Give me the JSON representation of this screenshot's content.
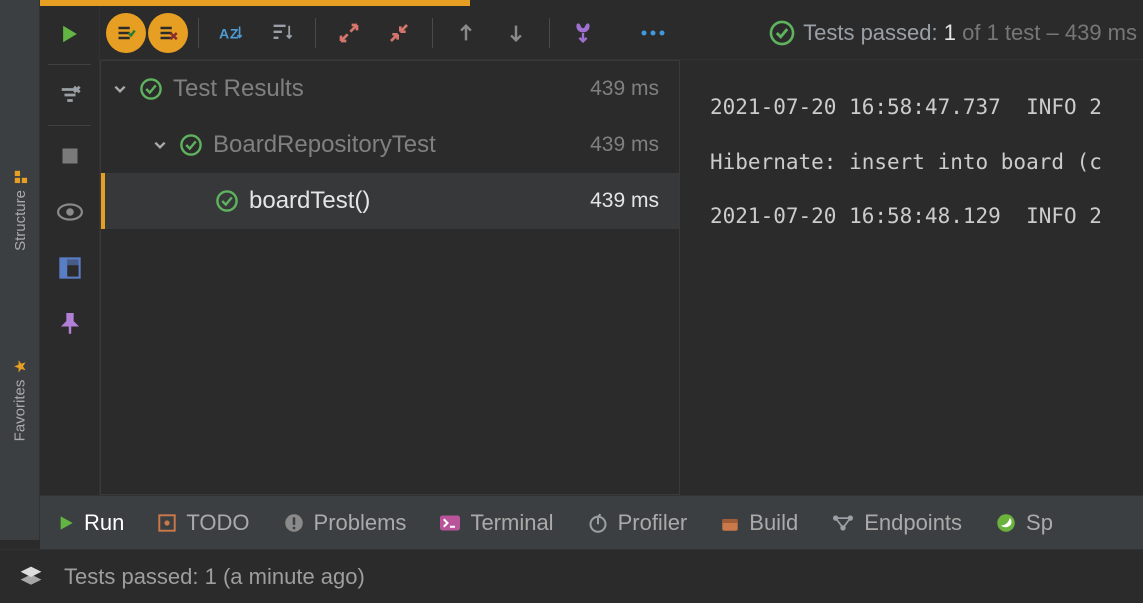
{
  "left_tabs": {
    "structure": "Structure",
    "favorites": "Favorites"
  },
  "toolbar_status": {
    "label": "Tests passed:",
    "passed": "1",
    "rest": "of 1 test – 439 ms"
  },
  "tree": {
    "root": {
      "label": "Test Results",
      "time": "439 ms"
    },
    "class": {
      "label": "BoardRepositoryTest",
      "time": "439 ms"
    },
    "method": {
      "label": "boardTest()",
      "time": "439 ms"
    }
  },
  "console": {
    "l1": "2021-07-20 16:58:47.737  INFO 2",
    "l2": "Hibernate: insert into board (c",
    "l3": "2021-07-20 16:58:48.129  INFO 2"
  },
  "bottom_tabs": {
    "run": "Run",
    "todo": "TODO",
    "problems": "Problems",
    "terminal": "Terminal",
    "profiler": "Profiler",
    "build": "Build",
    "endpoints": "Endpoints",
    "spring": "Sp"
  },
  "status_bar": {
    "msg": "Tests passed: 1 (a minute ago)"
  }
}
